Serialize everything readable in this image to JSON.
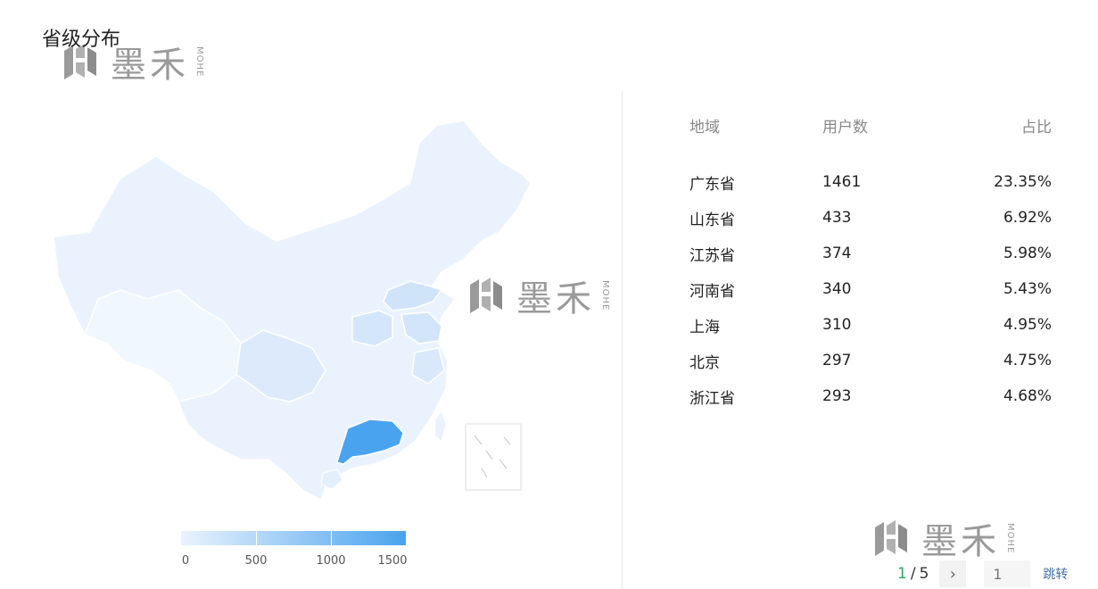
{
  "page": {
    "title": "省级分布"
  },
  "watermark": {
    "word": "墨禾",
    "small": "MOHE"
  },
  "legend": {
    "labels": [
      "0",
      "500",
      "1000",
      "1500"
    ],
    "min": 0,
    "max": 1600,
    "color_low": "#eaf3fd",
    "color_high": "#4aa3ee"
  },
  "table": {
    "headers": {
      "region": "地域",
      "users": "用户数",
      "ratio": "占比"
    },
    "rows": [
      {
        "region": "广东省",
        "users": "1461",
        "ratio": "23.35%"
      },
      {
        "region": "山东省",
        "users": "433",
        "ratio": "6.92%"
      },
      {
        "region": "江苏省",
        "users": "374",
        "ratio": "5.98%"
      },
      {
        "region": "河南省",
        "users": "340",
        "ratio": "5.43%"
      },
      {
        "region": "上海",
        "users": "310",
        "ratio": "4.95%"
      },
      {
        "region": "北京",
        "users": "297",
        "ratio": "4.75%"
      },
      {
        "region": "浙江省",
        "users": "293",
        "ratio": "4.68%"
      }
    ]
  },
  "pagination": {
    "current": "1",
    "separator": "/",
    "total": "5",
    "next_icon": "chevron-right-icon",
    "jump_placeholder": "1",
    "jump_label": "跳转"
  },
  "colors": {
    "accent_green": "#2aa85a",
    "map_high": "#4aa3ee",
    "map_low": "#eaf3fd"
  }
}
